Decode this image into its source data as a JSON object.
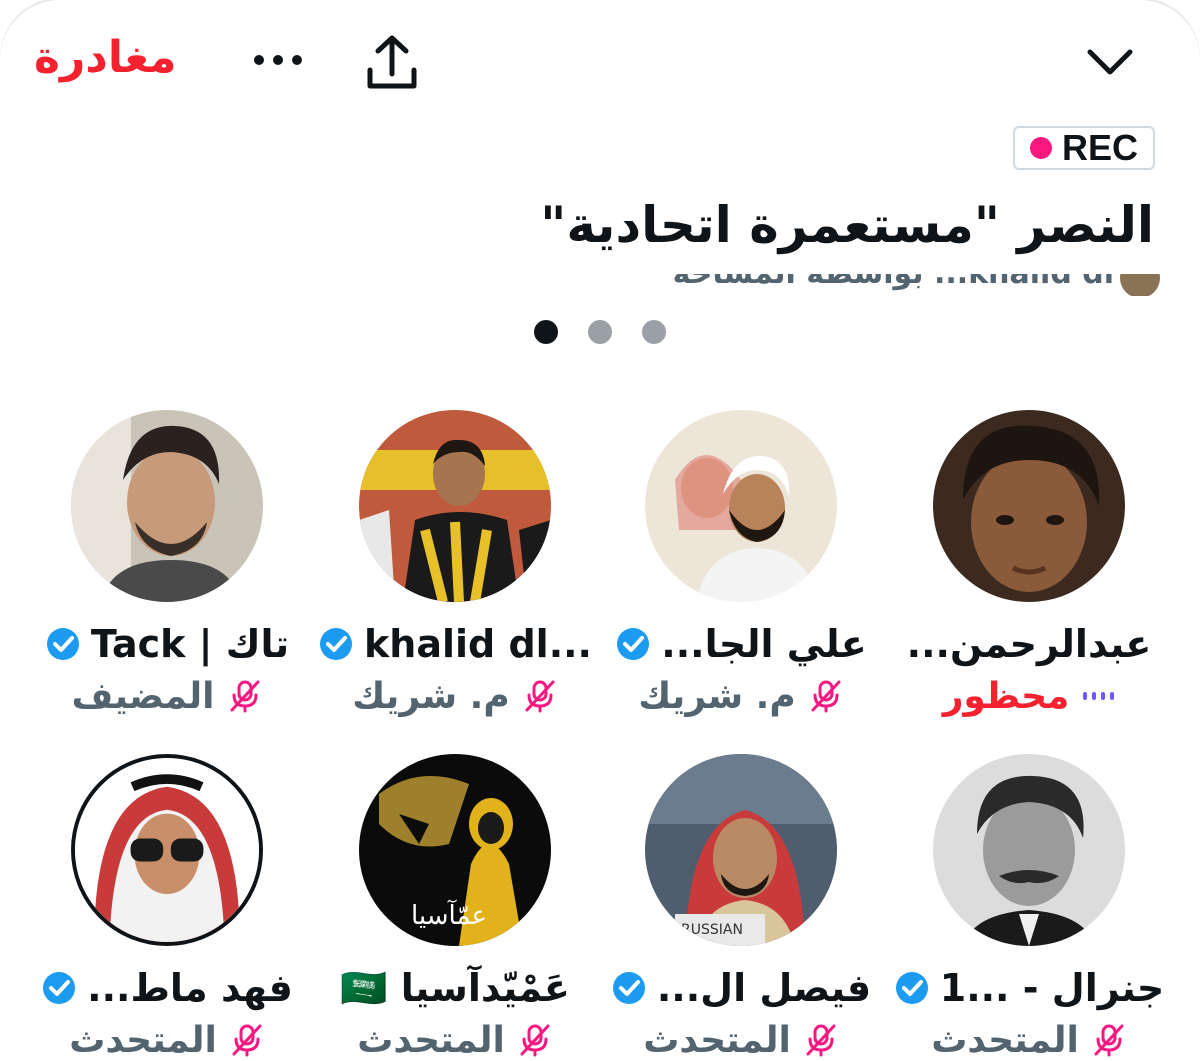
{
  "header": {
    "leave_label": "مغادرة",
    "more_icon": "more-horizontal-icon",
    "share_icon": "share-icon",
    "collapse_icon": "chevron-down-icon"
  },
  "space": {
    "rec_label": "REC",
    "title": "النصر \"مستعمرة اتحادية\"",
    "subtitle": "khalid dl... بواسطة المساحة",
    "page_count": 3,
    "active_page": 1
  },
  "colors": {
    "leave": "#f4212e",
    "rec_dot": "#f91880",
    "verified": "#1d9bf0",
    "mic_muted": "#f91880",
    "banned": "#f4212e",
    "speaking_dots": "#7856ff"
  },
  "participants": [
    {
      "name": "تاك | Tack",
      "verified": true,
      "role": "المضيف",
      "mic": "muted",
      "banned": false
    },
    {
      "name": "khalid dl...",
      "verified": true,
      "role": "م. شريك",
      "mic": "muted",
      "banned": false
    },
    {
      "name": "علي الجا...",
      "verified": true,
      "role": "م. شريك",
      "mic": "muted",
      "banned": false
    },
    {
      "name": "عبدالرحمن...",
      "verified": false,
      "role": "محظور",
      "mic": "speaking",
      "banned": true
    },
    {
      "name": "فهد ماط...",
      "verified": true,
      "role": "المتحدث",
      "mic": "muted",
      "banned": false
    },
    {
      "name": "عَمْيّدآسيا 🇸🇦",
      "verified": false,
      "role": "المتحدث",
      "mic": "muted",
      "banned": false
    },
    {
      "name": "فيصل ال...",
      "verified": true,
      "role": "المتحدث",
      "mic": "muted",
      "banned": false
    },
    {
      "name": "جنرال - ...1",
      "verified": true,
      "role": "المتحدث",
      "mic": "muted",
      "banned": false
    }
  ]
}
